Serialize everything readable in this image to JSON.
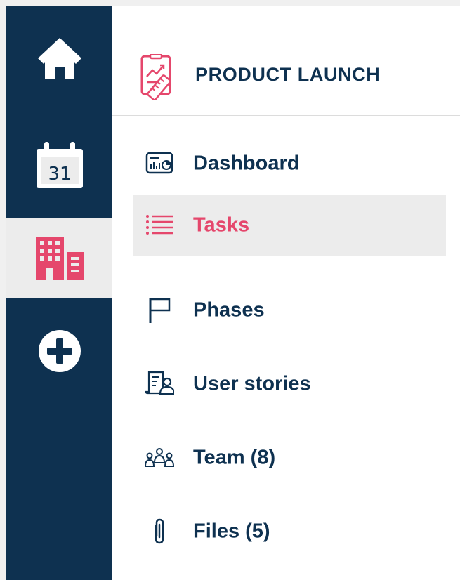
{
  "colors": {
    "rail": "#0e3150",
    "accent": "#e5476c",
    "text": "#0e3150",
    "active_bg": "#ececec"
  },
  "rail": {
    "items": [
      {
        "icon": "home-icon",
        "active": false
      },
      {
        "icon": "calendar-icon",
        "label": "31",
        "active": false
      },
      {
        "icon": "building-icon",
        "active": true
      },
      {
        "icon": "plus-circle-icon",
        "active": false
      }
    ]
  },
  "project": {
    "title": "PRODUCT LAUNCH",
    "icon": "project-chart-icon"
  },
  "nav": {
    "items": [
      {
        "label": "Dashboard",
        "icon": "dashboard-icon",
        "active": false
      },
      {
        "label": "Tasks",
        "icon": "list-icon",
        "active": true
      },
      {
        "label": "Phases",
        "icon": "flag-icon",
        "active": false
      },
      {
        "label": "User stories",
        "icon": "user-story-icon",
        "active": false
      },
      {
        "label": "Team (8)",
        "icon": "team-icon",
        "active": false
      },
      {
        "label": "Files (5)",
        "icon": "paperclip-icon",
        "active": false
      }
    ]
  }
}
